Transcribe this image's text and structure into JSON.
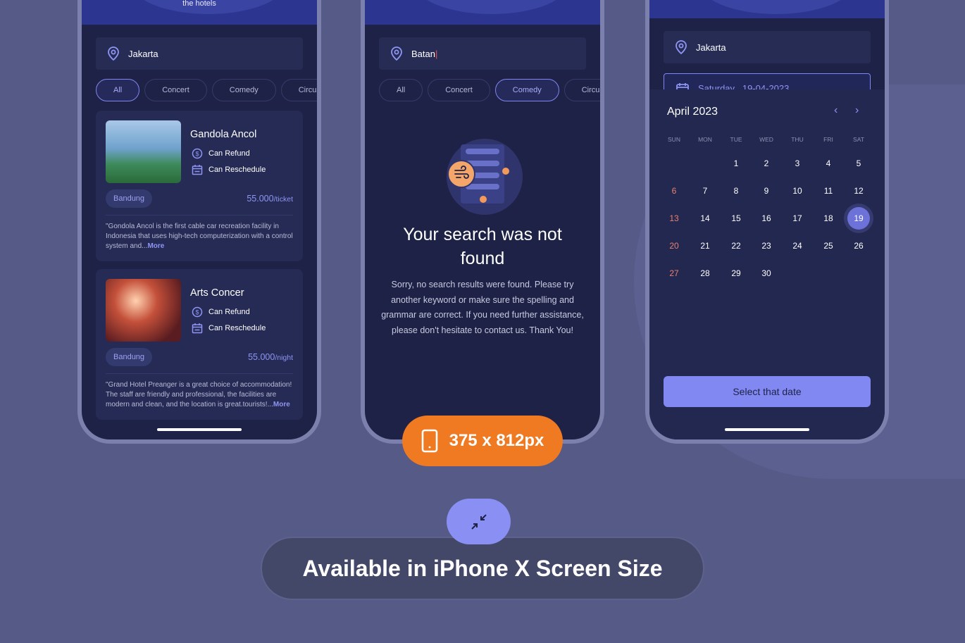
{
  "colors": {
    "background": "#555a86",
    "screen": "#1e2246",
    "accent": "#8188f2",
    "orange": "#f07a22",
    "sunday": "#e8806e"
  },
  "phone1": {
    "header_text": "the hotels",
    "location": "Jakarta",
    "chips": [
      {
        "label": "All",
        "active": true
      },
      {
        "label": "Concert",
        "active": false
      },
      {
        "label": "Comedy",
        "active": false
      },
      {
        "label": "Circus",
        "active": false
      }
    ],
    "cards": [
      {
        "title": "Gandola Ancol",
        "refund": "Can Refund",
        "reschedule": "Can Reschedule",
        "city": "Bandung",
        "price": "55.000",
        "unit": "/ticket",
        "desc": "\"Gondola Ancol is the first cable car recreation facility in Indonesia that uses high-tech computerization with a control system and...",
        "more": "More"
      },
      {
        "title": "Arts Concer",
        "refund": "Can Refund",
        "reschedule": "Can Reschedule",
        "city": "Bandung",
        "price": "55.000",
        "unit": "/night",
        "desc": "\"Grand Hotel Preanger is a great choice of accommodation! The staff are friendly and professional, the facilities are modern and clean, and the location is great.tourists!...",
        "more": "More"
      }
    ]
  },
  "phone2": {
    "search_value": "Batan",
    "chips": [
      {
        "label": "All",
        "active": false
      },
      {
        "label": "Concert",
        "active": false
      },
      {
        "label": "Comedy",
        "active": true
      },
      {
        "label": "Circus",
        "active": false
      }
    ],
    "empty_title": "Your search was not found",
    "empty_text": "Sorry, no search results were found. Please try another keyword or make sure the spelling and grammar are correct. If you need further assistance, please don't hesitate to contact us. Thank You!"
  },
  "phone3": {
    "location": "Jakarta",
    "date": "Saturday , 19-04-2023",
    "month": "April 2023",
    "weekdays": [
      "SUN",
      "MON",
      "TUE",
      "WED",
      "THU",
      "FRI",
      "SAT"
    ],
    "first_weekday": 2,
    "days_in_month": 30,
    "selected_day": 19,
    "button": "Select that date"
  },
  "size_badge": "375 x 812px",
  "banner": "Available in iPhone X Screen Size"
}
